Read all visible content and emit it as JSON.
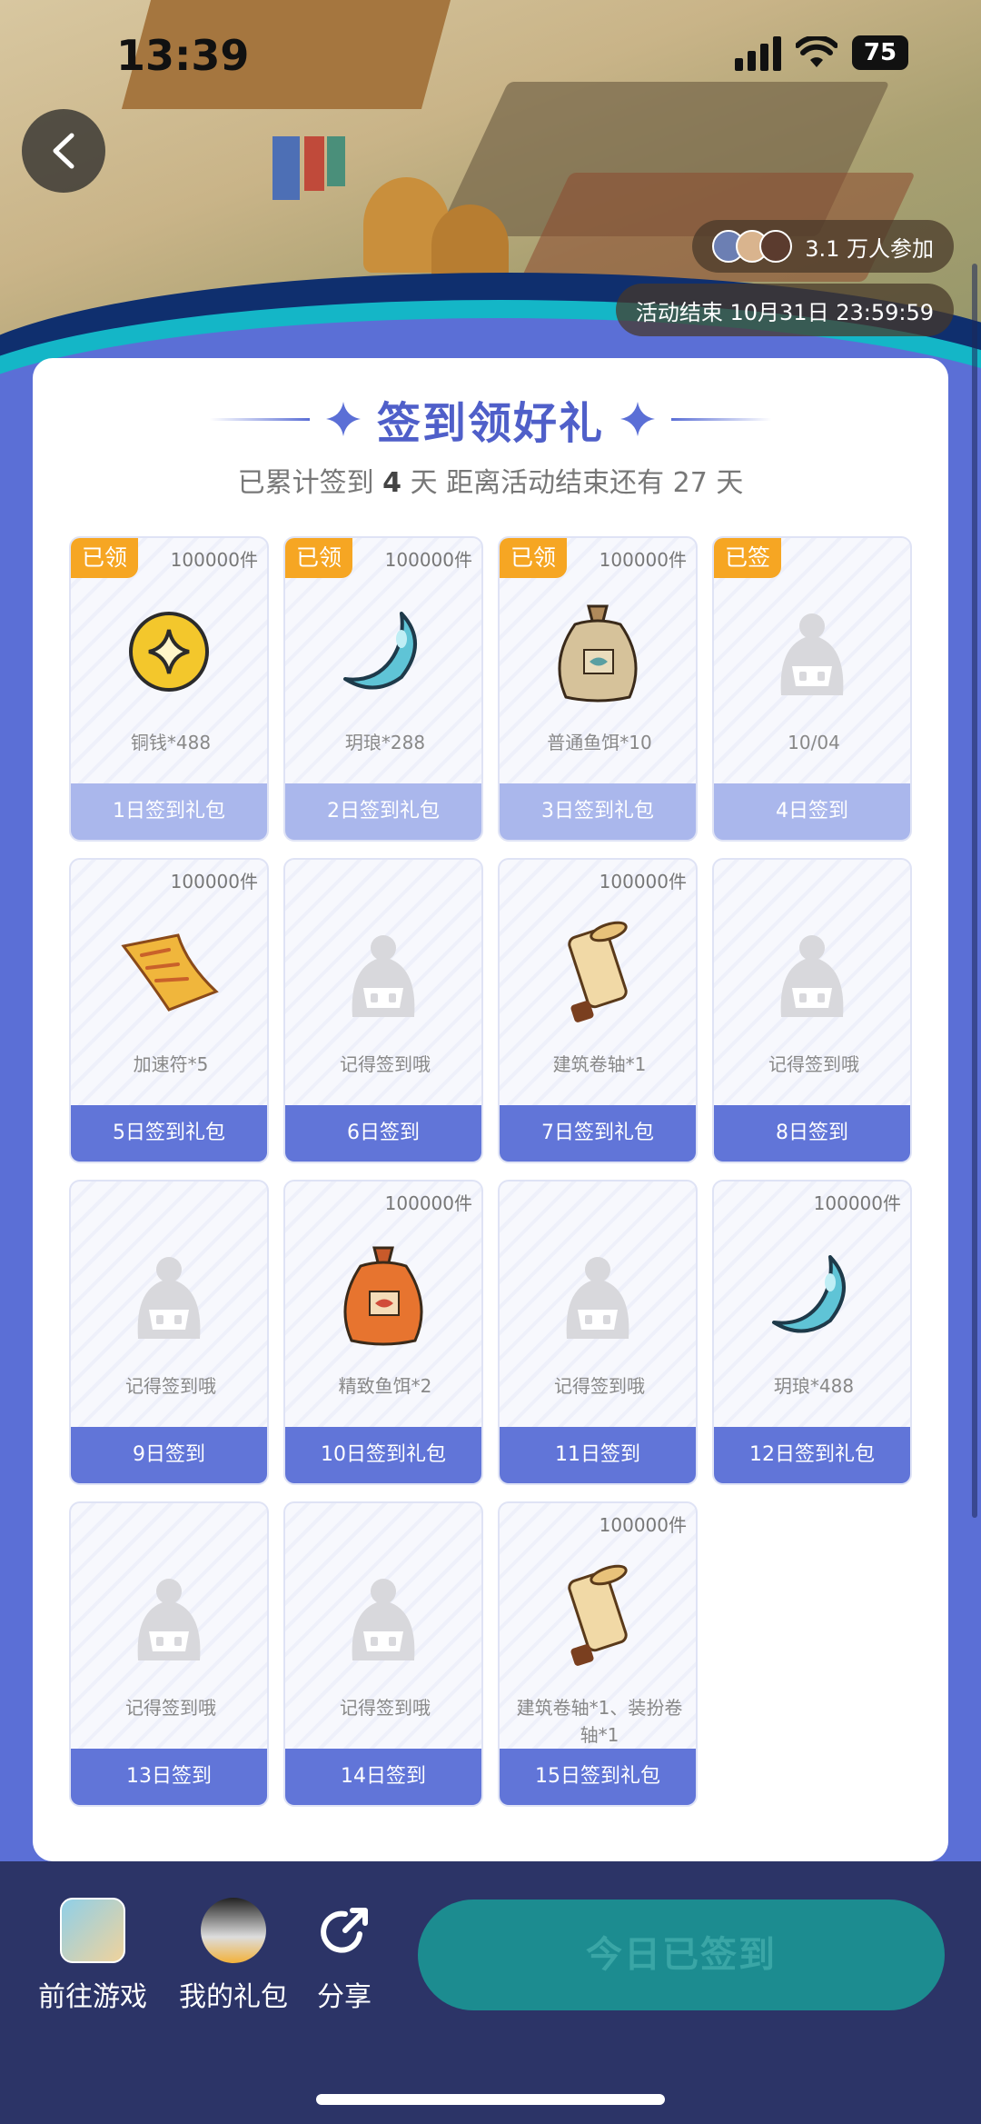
{
  "status_bar": {
    "time": "13:39",
    "battery": "75"
  },
  "banner": {
    "participants": "3.1 万人参加",
    "end_time": "活动结束 10月31日 23:59:59"
  },
  "card": {
    "title": "签到领好礼",
    "subtitle_prefix": "已累计签到",
    "signed_days": "4",
    "subtitle_mid": "天  距离活动结束还有",
    "remaining_days": "27",
    "subtitle_suffix": "天"
  },
  "days": [
    {
      "badge": "已领",
      "qty": "100000件",
      "reward": "铜钱*488",
      "footer": "1日签到礼包",
      "icon": "coin-icon",
      "state": "done"
    },
    {
      "badge": "已领",
      "qty": "100000件",
      "reward": "玥琅*288",
      "footer": "2日签到礼包",
      "icon": "crescent-gem-icon",
      "state": "done"
    },
    {
      "badge": "已领",
      "qty": "100000件",
      "reward": "普通鱼饵*10",
      "footer": "3日签到礼包",
      "icon": "bait-bag-icon",
      "state": "done"
    },
    {
      "badge": "已签",
      "qty": "",
      "reward": "10/04",
      "footer": "4日签到",
      "icon": "placeholder-icon",
      "state": "done"
    },
    {
      "badge": "",
      "qty": "100000件",
      "reward": "加速符*5",
      "footer": "5日签到礼包",
      "icon": "talisman-icon",
      "state": "todo"
    },
    {
      "badge": "",
      "qty": "",
      "reward": "记得签到哦",
      "footer": "6日签到",
      "icon": "placeholder-icon",
      "state": "todo"
    },
    {
      "badge": "",
      "qty": "100000件",
      "reward": "建筑卷轴*1",
      "footer": "7日签到礼包",
      "icon": "scroll-icon",
      "state": "todo"
    },
    {
      "badge": "",
      "qty": "",
      "reward": "记得签到哦",
      "footer": "8日签到",
      "icon": "placeholder-icon",
      "state": "todo"
    },
    {
      "badge": "",
      "qty": "",
      "reward": "记得签到哦",
      "footer": "9日签到",
      "icon": "placeholder-icon",
      "state": "todo"
    },
    {
      "badge": "",
      "qty": "100000件",
      "reward": "精致鱼饵*2",
      "footer": "10日签到礼包",
      "icon": "fine-bait-bag-icon",
      "state": "todo"
    },
    {
      "badge": "",
      "qty": "",
      "reward": "记得签到哦",
      "footer": "11日签到",
      "icon": "placeholder-icon",
      "state": "todo"
    },
    {
      "badge": "",
      "qty": "100000件",
      "reward": "玥琅*488",
      "footer": "12日签到礼包",
      "icon": "crescent-gem-icon",
      "state": "todo"
    },
    {
      "badge": "",
      "qty": "",
      "reward": "记得签到哦",
      "footer": "13日签到",
      "icon": "placeholder-icon",
      "state": "todo"
    },
    {
      "badge": "",
      "qty": "",
      "reward": "记得签到哦",
      "footer": "14日签到",
      "icon": "placeholder-icon",
      "state": "todo"
    },
    {
      "badge": "",
      "qty": "100000件",
      "reward": "建筑卷轴*1、装扮卷轴*1",
      "footer": "15日签到礼包",
      "icon": "scroll-icon",
      "state": "todo"
    }
  ],
  "bottom_bar": {
    "go_game": "前往游戏",
    "my_gifts": "我的礼包",
    "share": "分享",
    "sign_button": "今日已签到"
  },
  "colors": {
    "primary": "#6175d8",
    "claimed_footer": "#aab7ec",
    "badge": "#f6a623",
    "bottom_bar": "#2c3467",
    "sign_button": "#1c8c90"
  }
}
